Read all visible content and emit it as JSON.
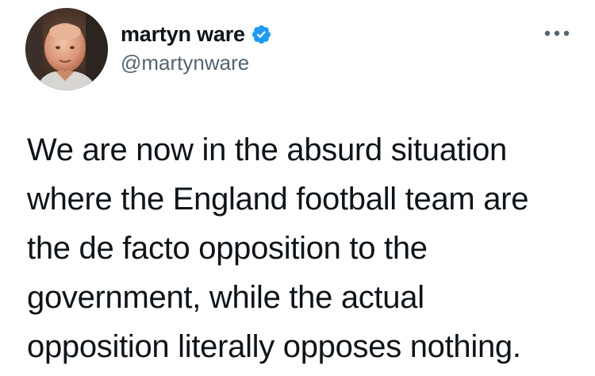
{
  "tweet": {
    "author": {
      "display_name": "martyn ware",
      "handle": "@martynware",
      "verified": true,
      "avatar_icon": "profile-photo"
    },
    "more_icon": "ellipsis-icon",
    "text_lines": [
      "We are now in the absurd situation",
      "where the England football team are",
      "the de facto opposition to the",
      "government, while the actual",
      "opposition literally opposes nothing."
    ]
  },
  "colors": {
    "text": "#0f1419",
    "secondary_text": "#536471",
    "verified_blue": "#1d9bf0",
    "background": "#ffffff"
  }
}
